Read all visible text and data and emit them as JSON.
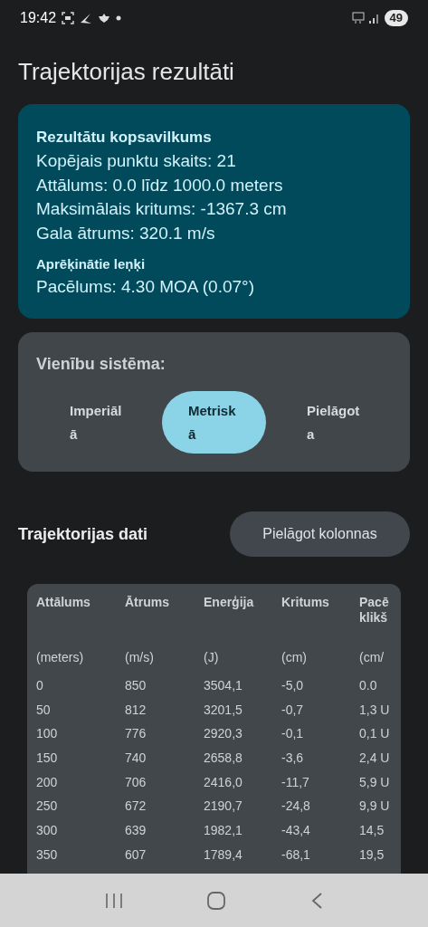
{
  "status_bar": {
    "time": "19:42",
    "battery": "49"
  },
  "title": "Trajektorijas rezultāti",
  "summary": {
    "heading": "Rezultātu kopsavilkums",
    "lines": [
      "Kopējais punktu skaits: 21",
      "Attālums: 0.0 līdz 1000.0 meters",
      "Maksimālais kritums: -1367.3 cm",
      "Gala ātrums: 320.1 m/s"
    ],
    "angles_heading": "Aprēķinātie leņķi",
    "angles_lines": [
      "Pacēlums: 4.30 MOA (0.07°)"
    ]
  },
  "units": {
    "label": "Vienību sistēma:",
    "options": [
      {
        "label": "Imperiāl\nā",
        "selected": false
      },
      {
        "label": "Metrisk\nā",
        "selected": true
      },
      {
        "label": "Pielāgot\na",
        "selected": false
      }
    ]
  },
  "data_section": {
    "heading": "Trajektorijas dati",
    "button": "Pielāgot kolonnas"
  },
  "table": {
    "columns": [
      {
        "name": "Attālums",
        "unit": "(meters)"
      },
      {
        "name": "Ātrums",
        "unit": "(m/s)"
      },
      {
        "name": "Enerģija",
        "unit": "(J)"
      },
      {
        "name": "Kritums",
        "unit": "(cm)"
      },
      {
        "name": "Pacē\nklikš",
        "unit": "(cm/"
      }
    ],
    "rows": [
      [
        "0",
        "850",
        "3504,1",
        "-5,0",
        "0.0"
      ],
      [
        "50",
        "812",
        "3201,5",
        "-0,7",
        "1,3 U"
      ],
      [
        "100",
        "776",
        "2920,3",
        "-0,1",
        "0,1 U"
      ],
      [
        "150",
        "740",
        "2658,8",
        "-3,6",
        "2,4 U"
      ],
      [
        "200",
        "706",
        "2416,0",
        "-11,7",
        "5,9 U"
      ],
      [
        "250",
        "672",
        "2190,7",
        "-24,8",
        "9,9 U"
      ],
      [
        "300",
        "639",
        "1982,1",
        "-43,4",
        "14,5"
      ],
      [
        "350",
        "607",
        "1789,4",
        "-68,1",
        "19,5"
      ]
    ]
  }
}
